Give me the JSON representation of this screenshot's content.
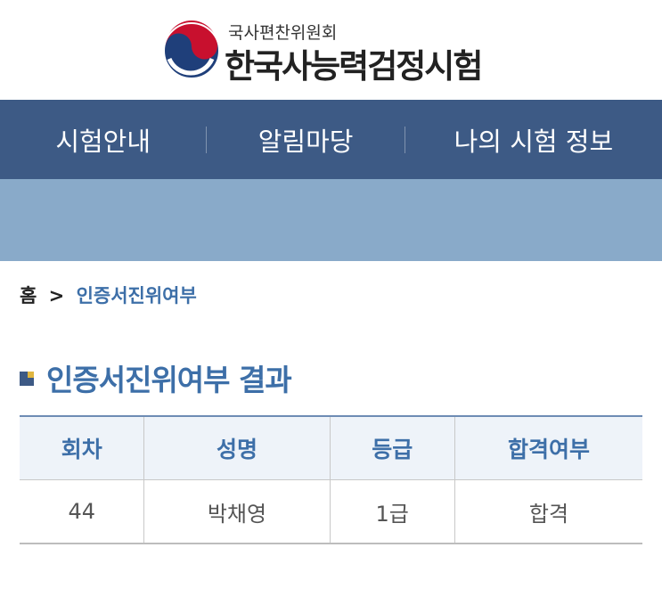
{
  "header": {
    "org_sub": "국사편찬위원회",
    "org_main": "한국사능력검정시험",
    "logo_icon": "taegeuk-logo-icon"
  },
  "nav": {
    "items": [
      {
        "label": "시험안내"
      },
      {
        "label": "알림마당"
      },
      {
        "label": "나의 시험 정보"
      }
    ]
  },
  "breadcrumb": {
    "home": "홈",
    "separator": ">",
    "current": "인증서진위여부"
  },
  "section": {
    "title": "인증서진위여부 결과"
  },
  "table": {
    "headers": [
      "회차",
      "성명",
      "등급",
      "합격여부"
    ],
    "rows": [
      [
        "44",
        "박채영",
        "1급",
        "합격"
      ]
    ]
  },
  "colors": {
    "nav_bg": "#3d5a85",
    "banner_bg": "#89aac9",
    "accent_text": "#3d6fa8",
    "bullet_accent": "#e0b640"
  }
}
